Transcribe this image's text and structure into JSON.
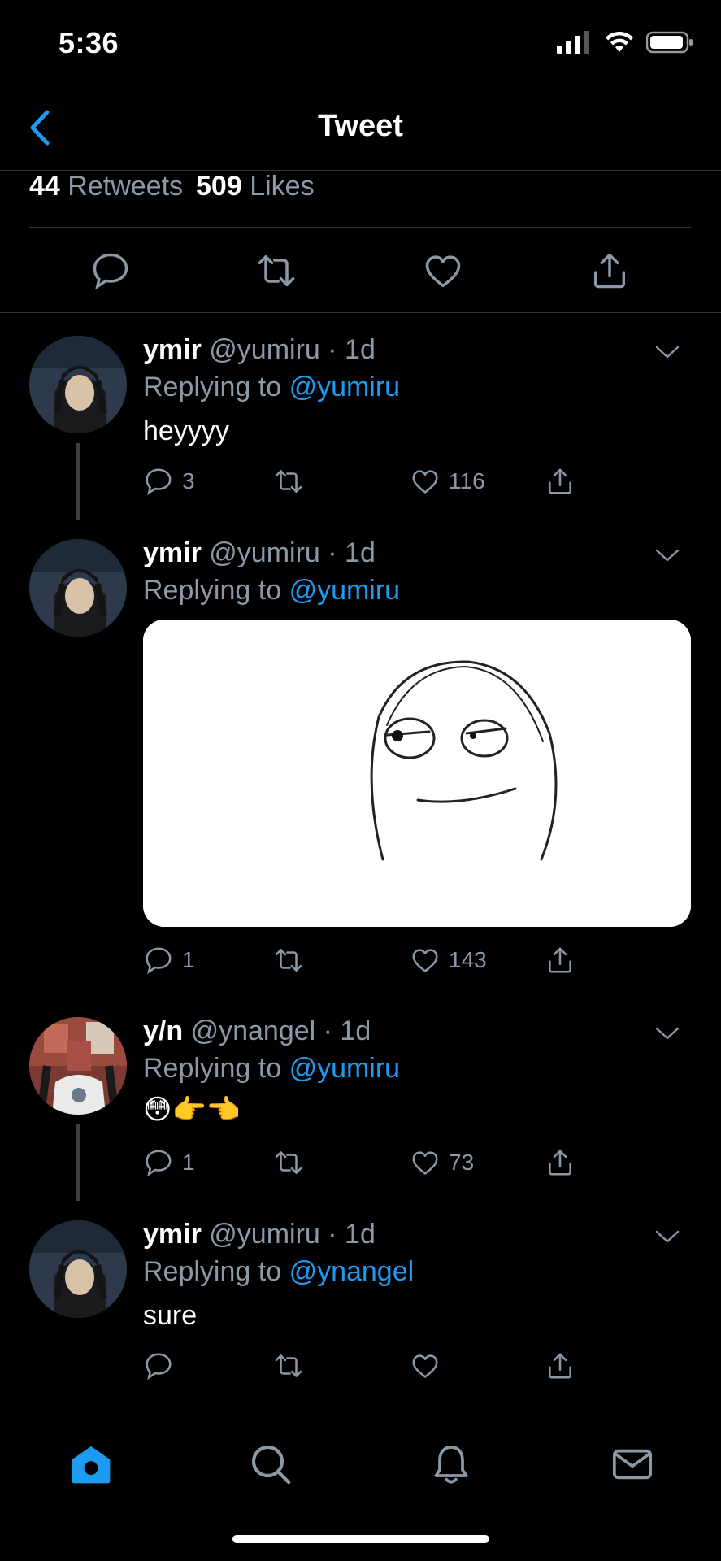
{
  "status_bar": {
    "time": "5:36"
  },
  "header": {
    "title": "Tweet"
  },
  "stats": {
    "retweets_count": "44",
    "retweets_label": "Retweets",
    "likes_count": "509",
    "likes_label": "Likes"
  },
  "colors": {
    "accent": "#1d9bf0",
    "muted": "#8b98a5",
    "divider": "#2f3336",
    "background": "#000000"
  },
  "replies": [
    {
      "name": "ymir",
      "handle": "@yumiru",
      "time": "1d",
      "replying_prefix": "Replying to",
      "replying_to": "@yumiru",
      "text": "heyyyy",
      "reply_count": "3",
      "retweet_count": "",
      "like_count": "116"
    },
    {
      "name": "ymir",
      "handle": "@yumiru",
      "time": "1d",
      "replying_prefix": "Replying to",
      "replying_to": "@yumiru",
      "text": "",
      "media": "meme-face-image",
      "reply_count": "1",
      "retweet_count": "",
      "like_count": "143"
    },
    {
      "name": "y/n",
      "handle": "@ynangel",
      "time": "1d",
      "replying_prefix": "Replying to",
      "replying_to": "@yumiru",
      "text": "😳👉👈",
      "reply_count": "1",
      "retweet_count": "",
      "like_count": "73"
    },
    {
      "name": "ymir",
      "handle": "@yumiru",
      "time": "1d",
      "replying_prefix": "Replying to",
      "replying_to": "@ynangel",
      "text": "sure",
      "reply_count": "",
      "retweet_count": "",
      "like_count": ""
    }
  ],
  "tabbar": {
    "tabs": [
      "home-icon",
      "search-icon",
      "bell-icon",
      "mail-icon"
    ],
    "active": "home-icon"
  }
}
